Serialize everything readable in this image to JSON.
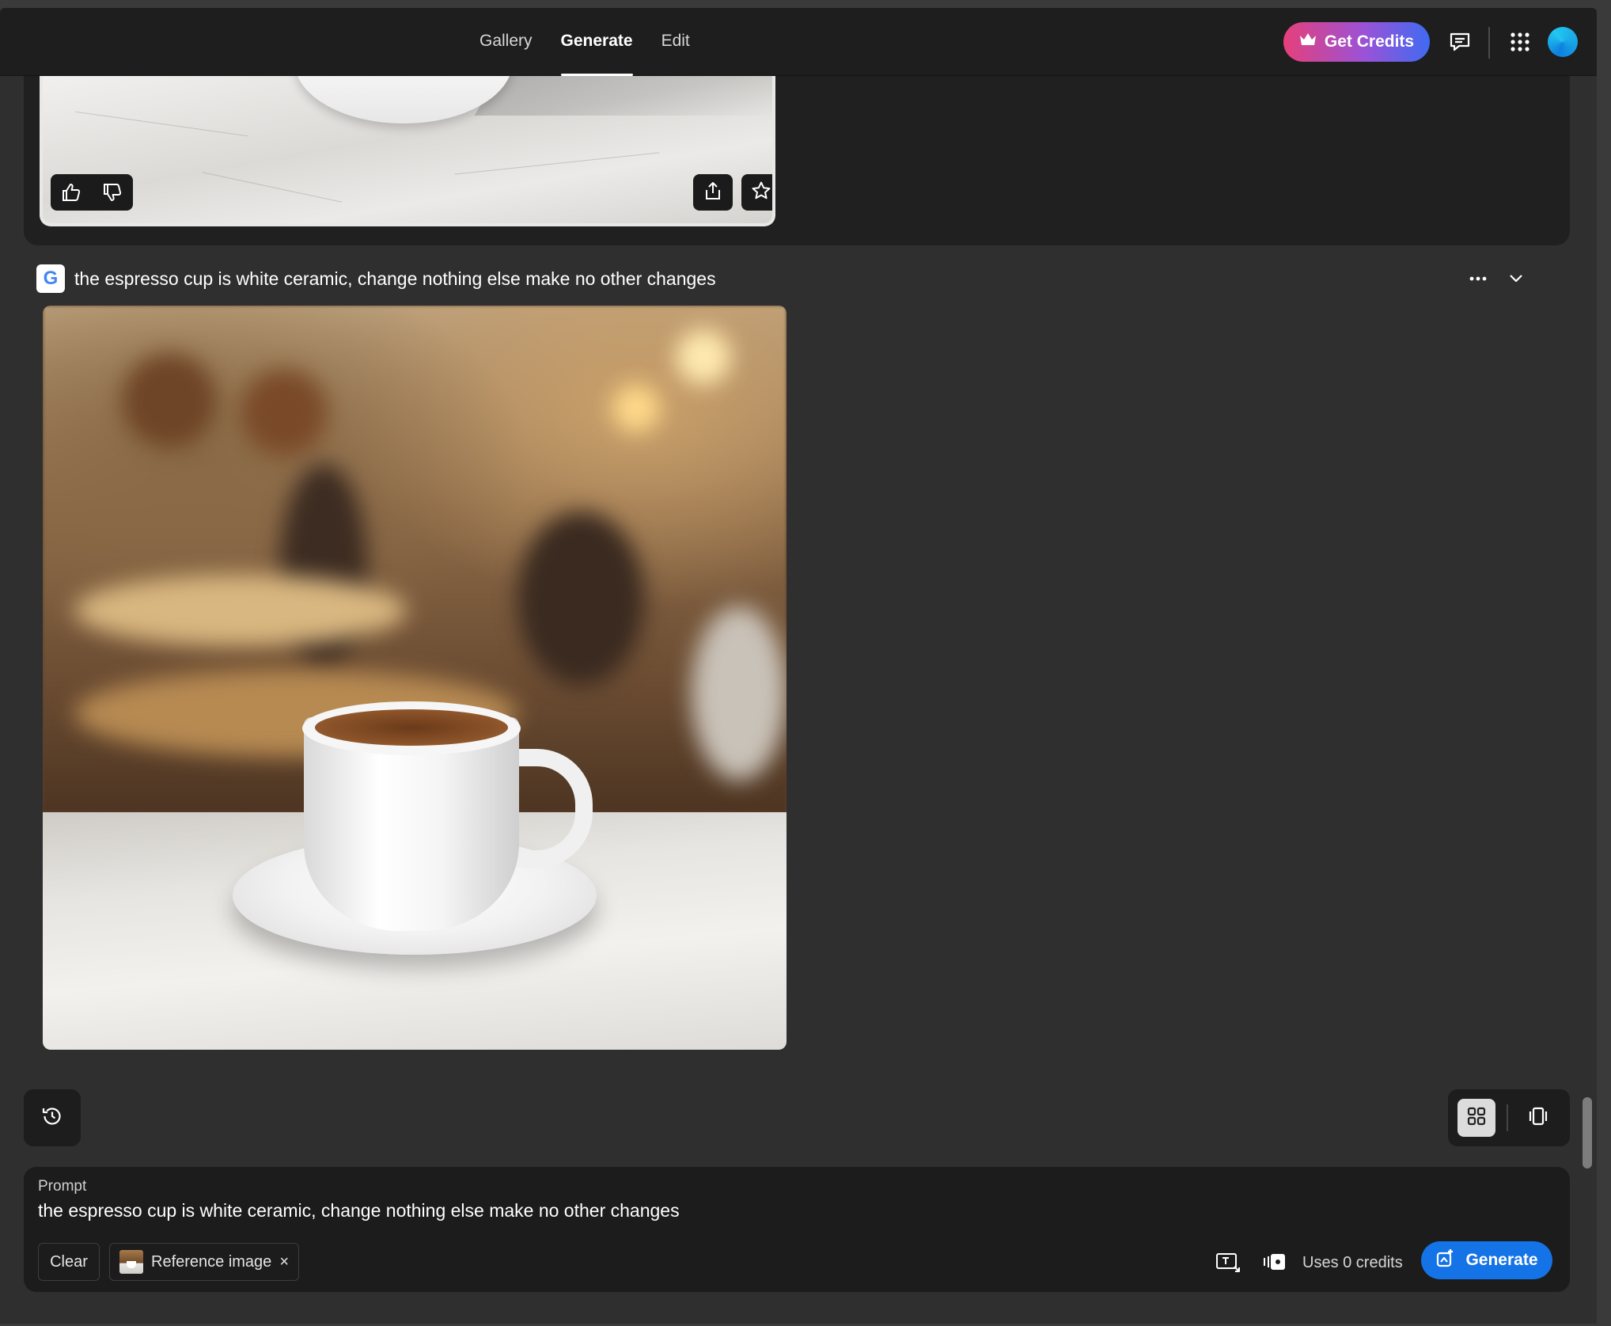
{
  "nav": {
    "tabs": [
      {
        "label": "Gallery",
        "active": false
      },
      {
        "label": "Generate",
        "active": true
      },
      {
        "label": "Edit",
        "active": false
      }
    ]
  },
  "header": {
    "credits_button": "Get Credits",
    "icons": [
      "crown-icon",
      "feedback-icon",
      "apps-grid-icon",
      "avatar"
    ]
  },
  "previous_result": {
    "actions": [
      "thumbs-up-icon",
      "thumbs-down-icon",
      "share-icon",
      "favorite-star-icon"
    ]
  },
  "generation": {
    "model_logo": "G",
    "prompt": "the espresso cup is white ceramic, change nothing else make no other changes",
    "actions": [
      "more-options-icon",
      "chevron-down-icon"
    ]
  },
  "prompt_panel": {
    "label": "Prompt",
    "value": "the espresso cup is white ceramic, change nothing else make no other changes",
    "clear_label": "Clear",
    "reference_chip": "Reference image",
    "chip_close": "×",
    "credits_text": "Uses 0 credits",
    "generate_label": "Generate"
  },
  "colors": {
    "accent": "#1473e6",
    "credits_gradient_start": "#e5407a",
    "credits_gradient_end": "#3f6bf2",
    "background": "#2f2f2f",
    "panel": "#1c1c1c"
  }
}
